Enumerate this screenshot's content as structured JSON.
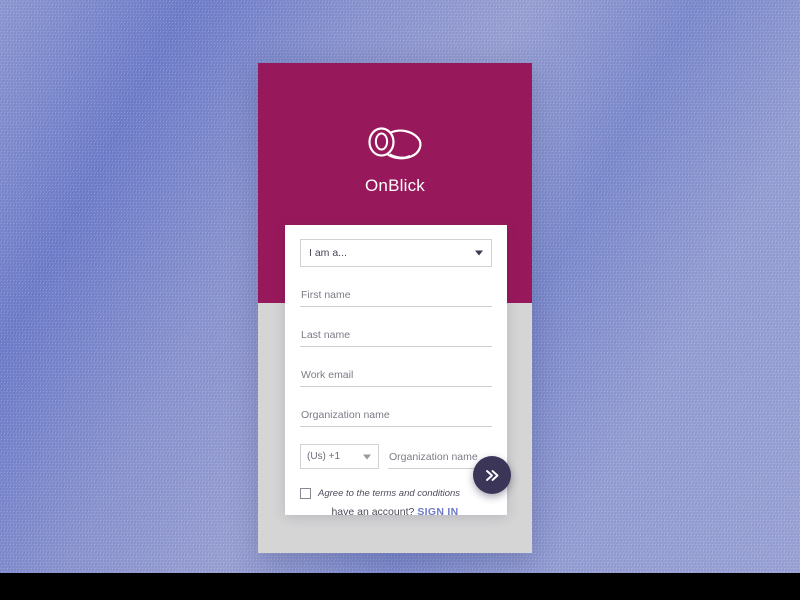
{
  "brand": {
    "name": "OnBlick",
    "logo_icon": "dog-head-outline-icon",
    "header_color": "#98195b"
  },
  "form": {
    "role_select": {
      "value": "I am a...",
      "caret_icon": "chevron-down-icon"
    },
    "fields": [
      {
        "placeholder": "First name",
        "value": ""
      },
      {
        "placeholder": "Last name",
        "value": ""
      },
      {
        "placeholder": "Work email",
        "value": ""
      },
      {
        "placeholder": "Organization name",
        "value": ""
      }
    ],
    "phone": {
      "country_code": "(Us) +1",
      "caret_icon": "chevron-down-icon",
      "placeholder": "Organization name",
      "value": ""
    },
    "terms": {
      "label": "Agree to the terms and conditions",
      "checked": false,
      "checkbox_icon": "checkbox-empty-icon"
    },
    "next_button": {
      "icon": "double-chevron-right-icon",
      "color": "#3b3558"
    }
  },
  "footer": {
    "prompt": "have an account?",
    "signin_label": "SIGN IN",
    "signin_color": "#6d7ac6"
  },
  "theme": {
    "backdrop_from": "#6f7ecd",
    "backdrop_to": "#9ba4d8",
    "card_body": "#d5d5d6",
    "sheet": "#ffffff",
    "bottom_bar": "#000000"
  }
}
